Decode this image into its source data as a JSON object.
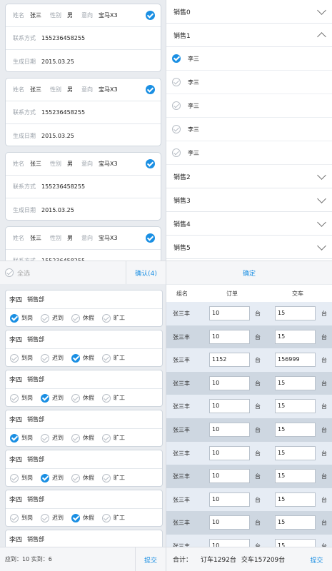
{
  "customer_cards": {
    "labels": {
      "name": "姓名",
      "gender": "性别",
      "intent": "意向",
      "contact": "联系方式",
      "date": "生成日期"
    },
    "items": [
      {
        "name": "张三",
        "gender": "男",
        "intent": "宝马X3",
        "contact": "155236458255",
        "date": "2015.03.25",
        "checked": true
      },
      {
        "name": "张三",
        "gender": "男",
        "intent": "宝马X3",
        "contact": "155236458255",
        "date": "2015.03.25",
        "checked": true
      },
      {
        "name": "张三",
        "gender": "男",
        "intent": "宝马X3",
        "contact": "155236458255",
        "date": "2015.03.25",
        "checked": true
      },
      {
        "name": "张三",
        "gender": "男",
        "intent": "宝马X3",
        "contact": "155236458255",
        "date": "",
        "checked": true
      }
    ],
    "footer": {
      "select_all": "全选",
      "confirm": "确认(4)"
    }
  },
  "sales_accordion": {
    "groups": [
      {
        "title": "销售0",
        "expanded": false
      },
      {
        "title": "销售1",
        "expanded": true,
        "members": [
          {
            "name": "李三",
            "selected": true
          },
          {
            "name": "李三",
            "selected": false
          },
          {
            "name": "李三",
            "selected": false
          },
          {
            "name": "李三",
            "selected": false
          },
          {
            "name": "李三",
            "selected": false
          }
        ]
      },
      {
        "title": "销售2",
        "expanded": false
      },
      {
        "title": "销售3",
        "expanded": false
      },
      {
        "title": "销售4",
        "expanded": false
      },
      {
        "title": "销售5",
        "expanded": false
      }
    ],
    "footer": {
      "confirm": "确定"
    }
  },
  "attendance": {
    "options": [
      "到岗",
      "迟到",
      "休假",
      "旷工"
    ],
    "records": [
      {
        "name": "李四",
        "dept": "销售部",
        "selected": 0
      },
      {
        "name": "李四",
        "dept": "销售部",
        "selected": 2
      },
      {
        "name": "李四",
        "dept": "销售部",
        "selected": 1
      },
      {
        "name": "李四",
        "dept": "销售部",
        "selected": 0
      },
      {
        "name": "李四",
        "dept": "销售部",
        "selected": 1
      },
      {
        "name": "李四",
        "dept": "销售部",
        "selected": 2
      },
      {
        "name": "李四",
        "dept": "销售部",
        "selected": -1
      }
    ],
    "footer": {
      "summary": "应到：10  实到：6",
      "submit": "提交"
    }
  },
  "order_table": {
    "headers": [
      "组名",
      "订单",
      "交车"
    ],
    "unit": "台",
    "rows": [
      {
        "name": "张三丰",
        "orders": "10",
        "deliveries": "15"
      },
      {
        "name": "张三丰",
        "orders": "10",
        "deliveries": "15"
      },
      {
        "name": "张三丰",
        "orders": "1152",
        "deliveries": "156999"
      },
      {
        "name": "张三丰",
        "orders": "10",
        "deliveries": "15"
      },
      {
        "name": "张三丰",
        "orders": "10",
        "deliveries": "15"
      },
      {
        "name": "张三丰",
        "orders": "10",
        "deliveries": "15"
      },
      {
        "name": "张三丰",
        "orders": "10",
        "deliveries": "15"
      },
      {
        "name": "张三丰",
        "orders": "10",
        "deliveries": "15"
      },
      {
        "name": "张三丰",
        "orders": "10",
        "deliveries": "15"
      },
      {
        "name": "张三丰",
        "orders": "10",
        "deliveries": "15"
      },
      {
        "name": "张三丰",
        "orders": "10",
        "deliveries": "15"
      }
    ],
    "footer": {
      "total_label": "合计：",
      "order_total": "订车1292台",
      "delivery_total": "交车157209台",
      "submit": "提交"
    }
  },
  "colors": {
    "accent": "#1a8fe3",
    "row_light": "#e6ecf4",
    "row_dark": "#ced7e1"
  }
}
